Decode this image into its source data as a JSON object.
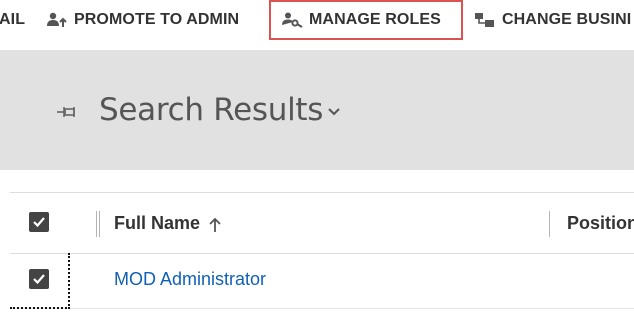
{
  "toolbar": {
    "items": [
      {
        "label": "AIL",
        "icon": "partial"
      },
      {
        "label": "PROMOTE TO ADMIN",
        "icon": "user-promote-icon"
      },
      {
        "label": "MANAGE ROLES",
        "icon": "user-key-icon",
        "highlighted": true
      },
      {
        "label": "CHANGE BUSINI",
        "icon": "business-unit-icon"
      }
    ],
    "highlight_color": "#d9534f"
  },
  "view": {
    "title": "Search Results",
    "pin_icon": "pin-icon",
    "dropdown_icon": "chevron-down-icon",
    "banner_color": "#e1e1e1"
  },
  "grid": {
    "columns": [
      {
        "label": "Full Name",
        "sort": "ascending"
      },
      {
        "label": "Position"
      }
    ],
    "rows": [
      {
        "full_name": "MOD Administrator",
        "selected": true
      }
    ],
    "link_color": "#1160b7"
  }
}
